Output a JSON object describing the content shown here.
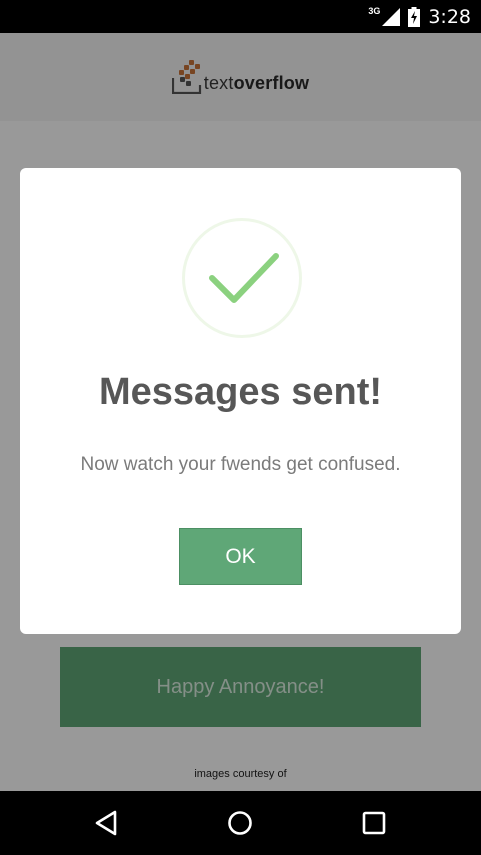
{
  "status_bar": {
    "network": "3G",
    "time": "3:28"
  },
  "app": {
    "logo": {
      "text_regular": "text",
      "text_bold": "overflow"
    },
    "cta_label": "Happy Annoyance!",
    "credits": "images courtesy of"
  },
  "dialog": {
    "title": "Messages sent!",
    "message": "Now watch your fwends get confused.",
    "ok_label": "OK",
    "icon": "checkmark-icon",
    "accent_color": "#5fa777",
    "check_color": "#8bd17f"
  },
  "nav_bar": {
    "buttons": [
      "back",
      "home",
      "recents"
    ]
  }
}
